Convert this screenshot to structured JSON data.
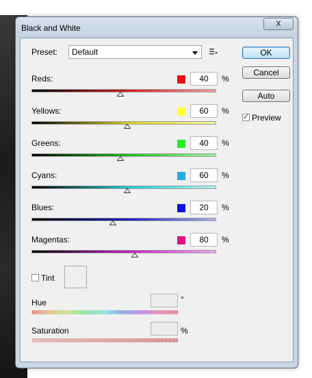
{
  "dialog": {
    "title": "Black and White",
    "close_glyph": "x"
  },
  "preset": {
    "label": "Preset:",
    "value": "Default",
    "menu_icon": "preset-options-icon"
  },
  "buttons": {
    "ok": "OK",
    "cancel": "Cancel",
    "auto": "Auto"
  },
  "preview": {
    "label": "Preview",
    "checked": true
  },
  "sliders": [
    {
      "label": "Reds:",
      "value": "40",
      "unit": "%",
      "swatch": "#ee1111",
      "grad_start": "#000000",
      "grad_mid": "#e02020",
      "grad_end": "#f0a0a0",
      "level": 0.48
    },
    {
      "label": "Yellows:",
      "value": "60",
      "unit": "%",
      "swatch": "#ffff33",
      "grad_start": "#000000",
      "grad_mid": "#d8d820",
      "grad_end": "#f6f6a0",
      "level": 0.52
    },
    {
      "label": "Greens:",
      "value": "40",
      "unit": "%",
      "swatch": "#22ee22",
      "grad_start": "#000000",
      "grad_mid": "#20c820",
      "grad_end": "#a0f0a0",
      "level": 0.48
    },
    {
      "label": "Cyans:",
      "value": "60",
      "unit": "%",
      "swatch": "#22aadd",
      "grad_start": "#000000",
      "grad_mid": "#20d0d0",
      "grad_end": "#b0f6f6",
      "level": 0.52
    },
    {
      "label": "Blues:",
      "value": "20",
      "unit": "%",
      "swatch": "#1111dd",
      "grad_start": "#000000",
      "grad_mid": "#2020c8",
      "grad_end": "#b0b0f0",
      "level": 0.44
    },
    {
      "label": "Magentas:",
      "value": "80",
      "unit": "%",
      "swatch": "#dd1188",
      "grad_start": "#000000",
      "grad_mid": "#d020d0",
      "grad_end": "#f0a8f0",
      "level": 0.56
    }
  ],
  "tint": {
    "label": "Tint",
    "checked": false
  },
  "hue": {
    "label": "Hue",
    "value": "",
    "unit": "°"
  },
  "saturation": {
    "label": "Saturation",
    "value": "",
    "unit": "%"
  }
}
